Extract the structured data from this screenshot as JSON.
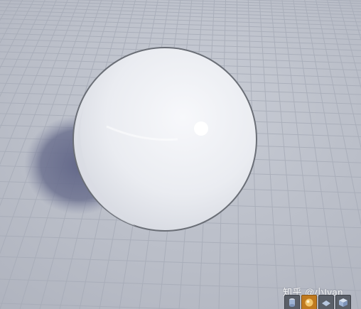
{
  "watermark": {
    "text": "知乎 @小Ivan"
  },
  "viewport": {
    "background_color": "#b9bdc7",
    "grid_line_color": "#a8adb8",
    "sphere_color": "#eceef2",
    "shadow_color": "#6d7290"
  },
  "toolbar": {
    "items": [
      {
        "icon": "cylinder-icon",
        "active": false
      },
      {
        "icon": "sphere-icon",
        "active": true
      },
      {
        "icon": "plane-icon",
        "active": false
      },
      {
        "icon": "cube-icon",
        "active": false
      }
    ]
  }
}
